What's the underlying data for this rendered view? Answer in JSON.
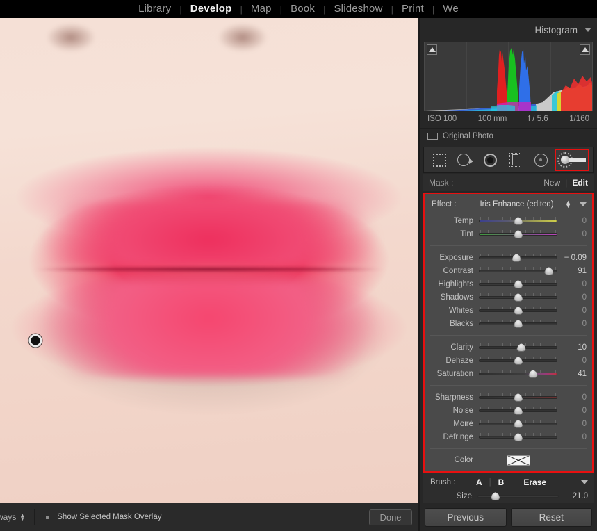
{
  "modules": [
    {
      "label": "Library",
      "active": false
    },
    {
      "label": "Develop",
      "active": true
    },
    {
      "label": "Map",
      "active": false
    },
    {
      "label": "Book",
      "active": false
    },
    {
      "label": "Slideshow",
      "active": false
    },
    {
      "label": "Print",
      "active": false
    },
    {
      "label": "We",
      "active": false
    }
  ],
  "panel": {
    "histogram_title": "Histogram",
    "exif": {
      "iso": "ISO 100",
      "focal": "100 mm",
      "aperture": "f / 5.6",
      "shutter": "1/160"
    },
    "original_photo_label": "Original Photo"
  },
  "tools": [
    {
      "name": "crop-overlay",
      "selected": false
    },
    {
      "name": "spot-removal",
      "selected": false
    },
    {
      "name": "red-eye-correction",
      "selected": false
    },
    {
      "name": "graduated-filter",
      "selected": false
    },
    {
      "name": "radial-filter",
      "selected": false
    },
    {
      "name": "adjustment-brush",
      "selected": true
    }
  ],
  "mask": {
    "label": "Mask :",
    "new_label": "New",
    "edit_label": "Edit"
  },
  "effect": {
    "label": "Effect :",
    "value": "Iris Enhance (edited)"
  },
  "slider_groups": [
    {
      "sliders": [
        {
          "label": "Temp",
          "value": "0",
          "pos": 50,
          "track": "track-temp",
          "zero": true
        },
        {
          "label": "Tint",
          "value": "0",
          "pos": 50,
          "track": "track-tint",
          "zero": true
        }
      ]
    },
    {
      "sliders": [
        {
          "label": "Exposure",
          "value": "− 0.09",
          "pos": 48,
          "track": "",
          "zero": false
        },
        {
          "label": "Contrast",
          "value": "91",
          "pos": 89,
          "track": "",
          "zero": false
        },
        {
          "label": "Highlights",
          "value": "0",
          "pos": 50,
          "track": "",
          "zero": true
        },
        {
          "label": "Shadows",
          "value": "0",
          "pos": 50,
          "track": "",
          "zero": true
        },
        {
          "label": "Whites",
          "value": "0",
          "pos": 50,
          "track": "",
          "zero": true
        },
        {
          "label": "Blacks",
          "value": "0",
          "pos": 50,
          "track": "",
          "zero": true
        }
      ]
    },
    {
      "sliders": [
        {
          "label": "Clarity",
          "value": "10",
          "pos": 54,
          "track": "",
          "zero": false
        },
        {
          "label": "Dehaze",
          "value": "0",
          "pos": 50,
          "track": "",
          "zero": true
        },
        {
          "label": "Saturation",
          "value": "41",
          "pos": 69,
          "track": "track-sat",
          "zero": false
        }
      ]
    },
    {
      "sliders": [
        {
          "label": "Sharpness",
          "value": "0",
          "pos": 50,
          "track": "track-sharp",
          "zero": true
        },
        {
          "label": "Noise",
          "value": "0",
          "pos": 50,
          "track": "",
          "zero": true
        },
        {
          "label": "Moiré",
          "value": "0",
          "pos": 50,
          "track": "",
          "zero": true
        },
        {
          "label": "Defringe",
          "value": "0",
          "pos": 50,
          "track": "",
          "zero": true
        }
      ]
    }
  ],
  "color": {
    "label": "Color",
    "swatch": "none"
  },
  "brush": {
    "label": "Brush :",
    "a_label": "A",
    "b_label": "B",
    "erase_label": "Erase",
    "size_label": "Size",
    "size_value": "21.0",
    "size_pos": 22
  },
  "bottom_toolbar": {
    "select_value": "ways",
    "overlay_label": "Show Selected Mask Overlay",
    "done_label": "Done"
  },
  "bottom_buttons": {
    "previous_label": "Previous",
    "reset_label": "Reset"
  },
  "colors": {
    "accent_red": "#e81010",
    "panel_bg": "#272727",
    "adj_bg": "#4a4a4a"
  }
}
